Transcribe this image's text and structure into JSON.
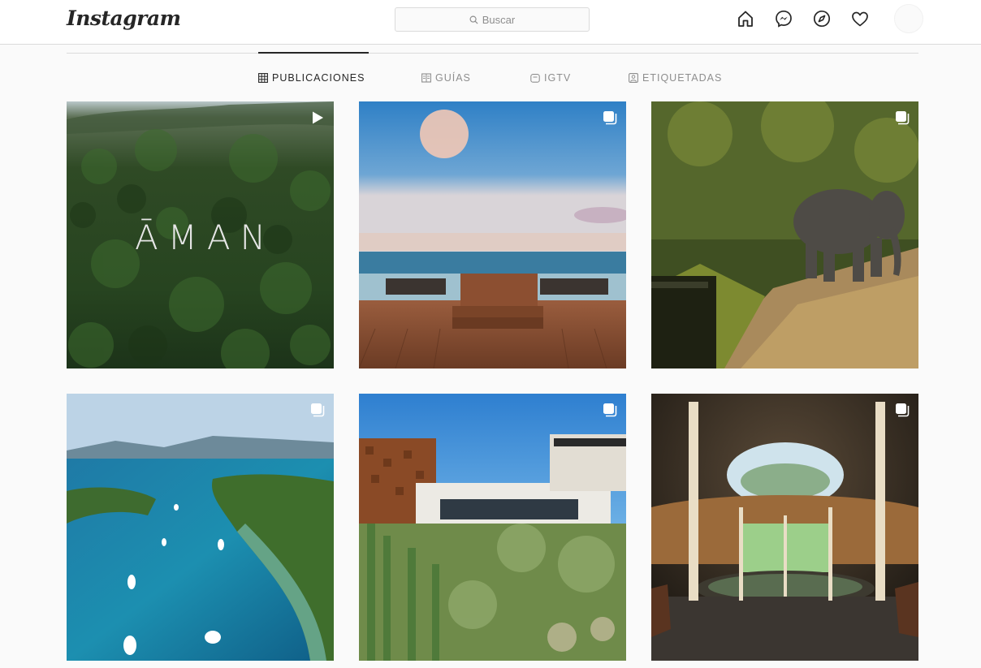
{
  "header": {
    "logo_text": "Instagram",
    "search": {
      "placeholder": "Buscar",
      "icon": "search-icon"
    },
    "nav_icons": [
      "home-icon",
      "messenger-icon",
      "explore-icon",
      "heart-icon"
    ]
  },
  "tabs": [
    {
      "label": "PUBLICACIONES",
      "icon": "grid-icon",
      "active": true
    },
    {
      "label": "GUÍAS",
      "icon": "guide-icon",
      "active": false
    },
    {
      "label": "IGTV",
      "icon": "igtv-icon",
      "active": false
    },
    {
      "label": "ETIQUETADAS",
      "icon": "tagged-icon",
      "active": false
    }
  ],
  "posts": [
    {
      "badge": "video-icon",
      "overlay_text": "ĀMAN"
    },
    {
      "badge": "carousel-icon"
    },
    {
      "badge": "carousel-icon"
    },
    {
      "badge": "carousel-icon"
    },
    {
      "badge": "carousel-icon"
    },
    {
      "badge": "carousel-icon"
    }
  ],
  "colors": {
    "background": "#fafafa",
    "border": "#dbdbdb",
    "text": "#262626",
    "muted": "#8e8e8e"
  }
}
